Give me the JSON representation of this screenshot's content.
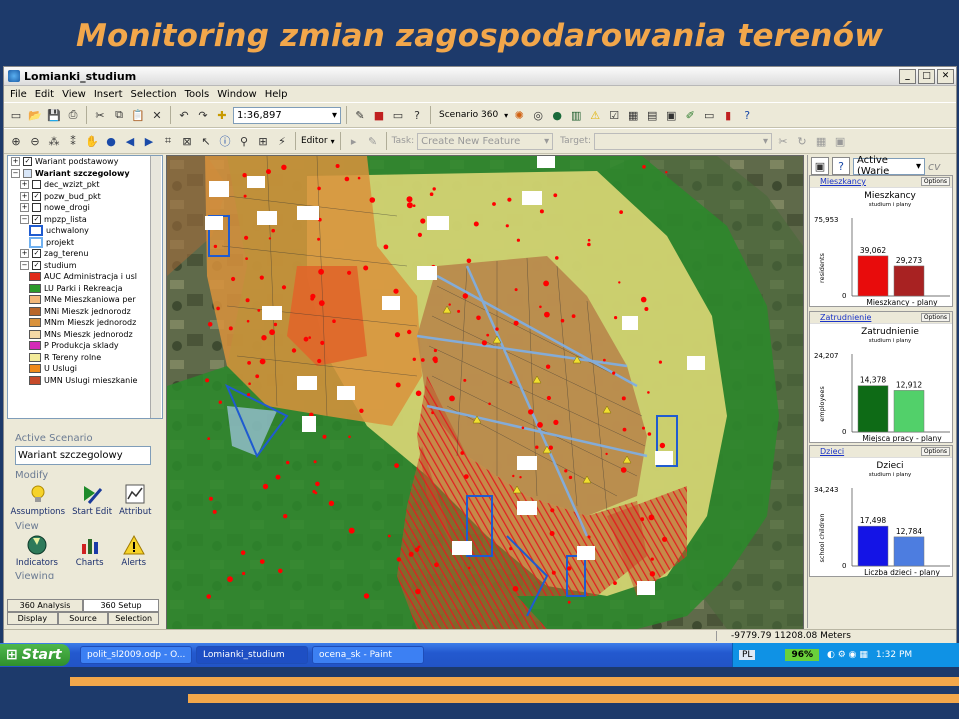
{
  "slide": {
    "title": "Monitoring zmian zagospodarowania terenów"
  },
  "window": {
    "title": "Lomianki_studium"
  },
  "menu": [
    "File",
    "Edit",
    "View",
    "Insert",
    "Selection",
    "Tools",
    "Window",
    "Help"
  ],
  "toolbar": {
    "scale": "1:36,897",
    "scenario_label": "Scenario 360",
    "editor_label": "Editor",
    "task_label": "Task:",
    "task_value": "Create New Feature",
    "target_label": "Target:"
  },
  "toc": {
    "items": [
      {
        "label": "Wariant podstawowy",
        "kind": "group",
        "pm": "+",
        "cb": "✓",
        "bold": false,
        "indent": 0
      },
      {
        "label": "Wariant szczegolowy",
        "kind": "group",
        "pm": "−",
        "cb": "",
        "bold": true,
        "indent": 0
      },
      {
        "label": "dec_wzizt_pkt",
        "kind": "layer",
        "pm": "+",
        "cb": "",
        "indent": 1
      },
      {
        "label": "pozw_bud_pkt",
        "kind": "layer",
        "pm": "+",
        "cb": "✓",
        "indent": 1
      },
      {
        "label": "nowe_drogi",
        "kind": "layer",
        "pm": "+",
        "cb": "",
        "indent": 1
      },
      {
        "label": "mpzp_lista",
        "kind": "layer",
        "pm": "−",
        "cb": "✓",
        "indent": 1
      },
      {
        "label": "uchwalony",
        "kind": "legend",
        "color": "#1f5bd0",
        "fill": "none",
        "indent": 2
      },
      {
        "label": "projekt",
        "kind": "legend",
        "color": "#6fb0f0",
        "fill": "none",
        "indent": 2
      },
      {
        "label": "zag_terenu",
        "kind": "layer",
        "pm": "+",
        "cb": "✓",
        "indent": 1
      },
      {
        "label": "studium",
        "kind": "layer",
        "pm": "−",
        "cb": "✓",
        "indent": 1
      },
      {
        "label": "AUC Administracja i usl",
        "kind": "legend",
        "color": "#555",
        "fill": "#e02a1a",
        "indent": 2
      },
      {
        "label": "LU Parki i Rekreacja",
        "kind": "legend",
        "color": "#555",
        "fill": "#2a9a2a",
        "indent": 2
      },
      {
        "label": "MNe Mieszkaniowa per",
        "kind": "legend",
        "color": "#555",
        "fill": "#f2b87a",
        "indent": 2
      },
      {
        "label": "MNi Mieszk jednorodz",
        "kind": "legend",
        "color": "#555",
        "fill": "#b8662a",
        "indent": 2
      },
      {
        "label": "MNm Mieszk jednorodz",
        "kind": "legend",
        "color": "#555",
        "fill": "#d9923c",
        "indent": 2
      },
      {
        "label": "MNs Mieszk jednorodz",
        "kind": "legend",
        "color": "#555",
        "fill": "#f4d9a6",
        "indent": 2
      },
      {
        "label": "P Produkcja sklady",
        "kind": "legend",
        "color": "#555",
        "fill": "#d42ab8",
        "indent": 2
      },
      {
        "label": "R Tereny rolne",
        "kind": "legend",
        "color": "#555",
        "fill": "#f4ec9a",
        "indent": 2
      },
      {
        "label": "U Uslugi",
        "kind": "legend",
        "color": "#555",
        "fill": "#f08a1a",
        "indent": 2
      },
      {
        "label": "UMN Uslugi mieszkanie",
        "kind": "legend",
        "color": "#555",
        "fill": "#c64a2a",
        "indent": 2
      }
    ]
  },
  "scenario": {
    "active_label": "Active Scenario",
    "active_value": "Wariant szczegolowy",
    "modify_label": "Modify",
    "modify_buttons": [
      "Assumptions",
      "Start Edit",
      "Attribut"
    ],
    "view_label": "View",
    "view_buttons": [
      "Indicators",
      "Charts",
      "Alerts"
    ],
    "viewing_label": "Viewing"
  },
  "bottom_tabs": {
    "row1": [
      "360 Analysis",
      "360 Setup"
    ],
    "row2": [
      "Display",
      "Source",
      "Selection"
    ]
  },
  "right_panel": {
    "combo": "Active (Warie",
    "charts": [
      {
        "link": "Mieszkancy",
        "title": "Mieszkancy",
        "subtitle": "studium i plany",
        "ylabel": "residents",
        "ymax_label": "75,953",
        "zero": "0",
        "xlabel": "Mieszkancy - plany",
        "options": "Options",
        "bars": [
          {
            "label": "39,062",
            "value": 39062,
            "color": "#e80c0c"
          },
          {
            "label": "29,273",
            "value": 29273,
            "color": "#a82222"
          }
        ],
        "ymax": 75953
      },
      {
        "link": "Zatrudnienie",
        "title": "Zatrudnienie",
        "subtitle": "studium i plany",
        "ylabel": "employees",
        "ymax_label": "24,207",
        "zero": "0",
        "xlabel": "Miejsca pracy - plany",
        "options": "Options",
        "bars": [
          {
            "label": "14,378",
            "value": 14378,
            "color": "#0e6b16"
          },
          {
            "label": "12,912",
            "value": 12912,
            "color": "#52d06a"
          }
        ],
        "ymax": 24207
      },
      {
        "link": "Dzieci",
        "title": "Dzieci",
        "subtitle": "studium i plany",
        "ylabel": "school children",
        "ymax_label": "34,243",
        "zero": "0",
        "xlabel": "Liczba dzieci - plany",
        "options": "Options",
        "bars": [
          {
            "label": "17,498",
            "value": 17498,
            "color": "#1414e6"
          },
          {
            "label": "12,784",
            "value": 12784,
            "color": "#4d7de0"
          }
        ],
        "ymax": 34243
      }
    ]
  },
  "status": {
    "coords": "-9779.79  11208.08 Meters"
  },
  "taskbar": {
    "start": "Start",
    "tasks": [
      "polit_sl2009.odp - O...",
      "Lomianki_studium",
      "ocena_sk - Paint"
    ],
    "lang": "PL",
    "battery": "96%",
    "clock": "1:32 PM"
  }
}
